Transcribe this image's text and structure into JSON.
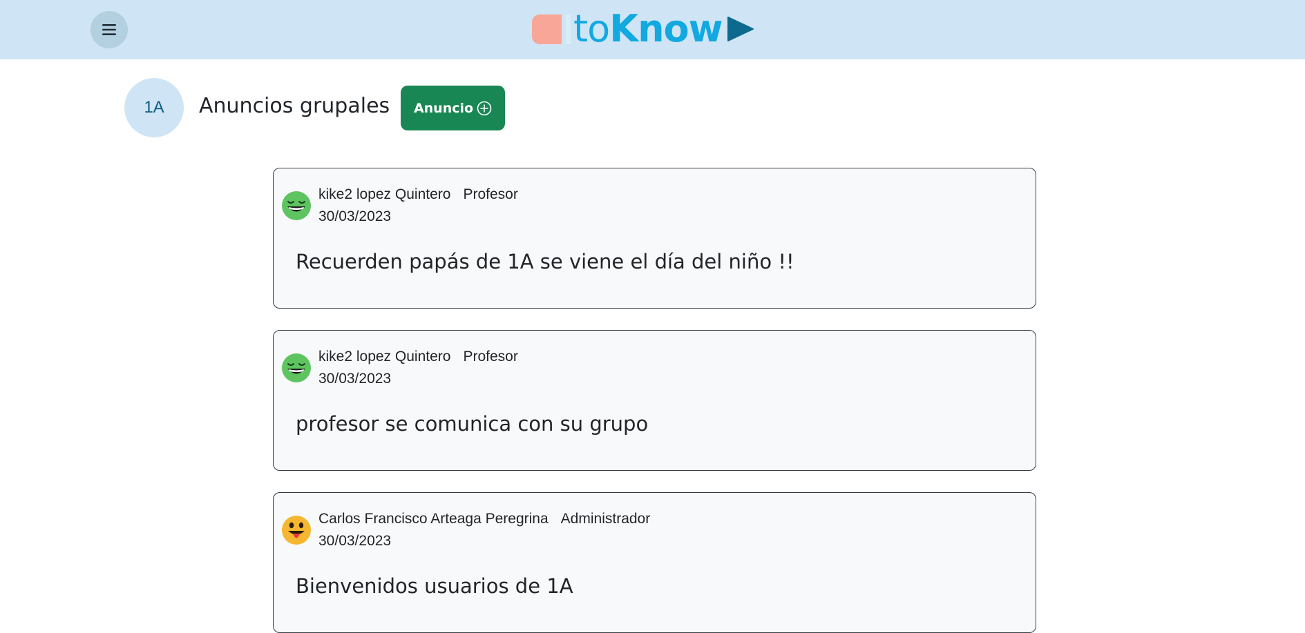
{
  "header": {
    "menu_icon": "hamburger-menu-icon",
    "logo": {
      "text_light": "to",
      "text_bold": "Know",
      "text_color": "#12a8e0",
      "accent_block_color": "#f8a697",
      "play_color": "#0d6a8e"
    },
    "background": "#cfe5f6"
  },
  "group": {
    "badge": "1A",
    "title": "Anuncios grupales",
    "new_button_label": "Anuncio",
    "new_button_icon": "plus-circle-icon",
    "new_button_color": "#198754"
  },
  "announcements": [
    {
      "author": "kike2 lopez Quintero",
      "role": "Profesor",
      "date": "30/03/2023",
      "message": "Recuerden papás de 1A se viene el día del niño !!",
      "avatar": "grinning-face-green-icon"
    },
    {
      "author": "kike2 lopez Quintero",
      "role": "Profesor",
      "date": "30/03/2023",
      "message": "profesor se comunica con su grupo",
      "avatar": "grinning-face-green-icon"
    },
    {
      "author": "Carlos Francisco Arteaga Peregrina",
      "role": "Administrador",
      "date": "30/03/2023",
      "message": "Bienvenidos usuarios de 1A",
      "avatar": "tongue-out-face-yellow-icon"
    }
  ]
}
